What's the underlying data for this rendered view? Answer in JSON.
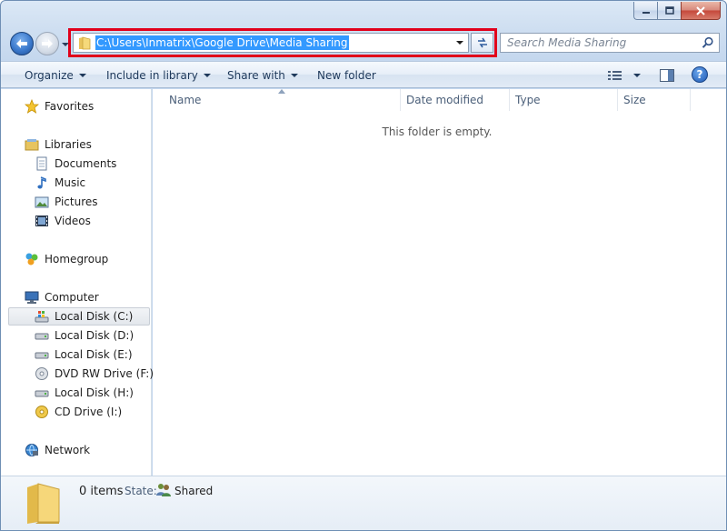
{
  "address": {
    "path": "C:\\Users\\Inmatrix\\Google Drive\\Media Sharing"
  },
  "search": {
    "placeholder": "Search Media Sharing"
  },
  "commands": {
    "organize": "Organize",
    "include_in_library": "Include in library",
    "share_with": "Share with",
    "new_folder": "New folder"
  },
  "help": {
    "label": "?"
  },
  "nav": {
    "favorites": "Favorites",
    "libraries": "Libraries",
    "documents": "Documents",
    "music": "Music",
    "pictures": "Pictures",
    "videos": "Videos",
    "homegroup": "Homegroup",
    "computer": "Computer",
    "local_disk_c": "Local Disk (C:)",
    "local_disk_d": "Local Disk (D:)",
    "local_disk_e": "Local Disk (E:)",
    "dvd_rw_f": "DVD RW Drive (F:)",
    "local_disk_h": "Local Disk (H:)",
    "cd_drive_i": "CD Drive (I:)",
    "network": "Network"
  },
  "columns": {
    "name": "Name",
    "date_modified": "Date modified",
    "type": "Type",
    "size": "Size"
  },
  "content": {
    "empty_message": "This folder is empty."
  },
  "details": {
    "item_count": "0 items",
    "state_label": "State:",
    "state_value": "Shared"
  },
  "colors": {
    "accent": "#3399ff",
    "highlight_outline": "#e1001b",
    "nav_text": "#1e395b"
  },
  "icons": {
    "back": "arrow-left-icon",
    "forward": "arrow-right-icon",
    "folder": "folder-icon",
    "refresh": "refresh-icon",
    "search": "search-icon",
    "star": "star-icon",
    "library": "library-icon",
    "homegroup": "homegroup-icon",
    "computer": "computer-icon",
    "drive": "drive-icon",
    "dvd": "dvd-icon",
    "network": "network-icon"
  }
}
